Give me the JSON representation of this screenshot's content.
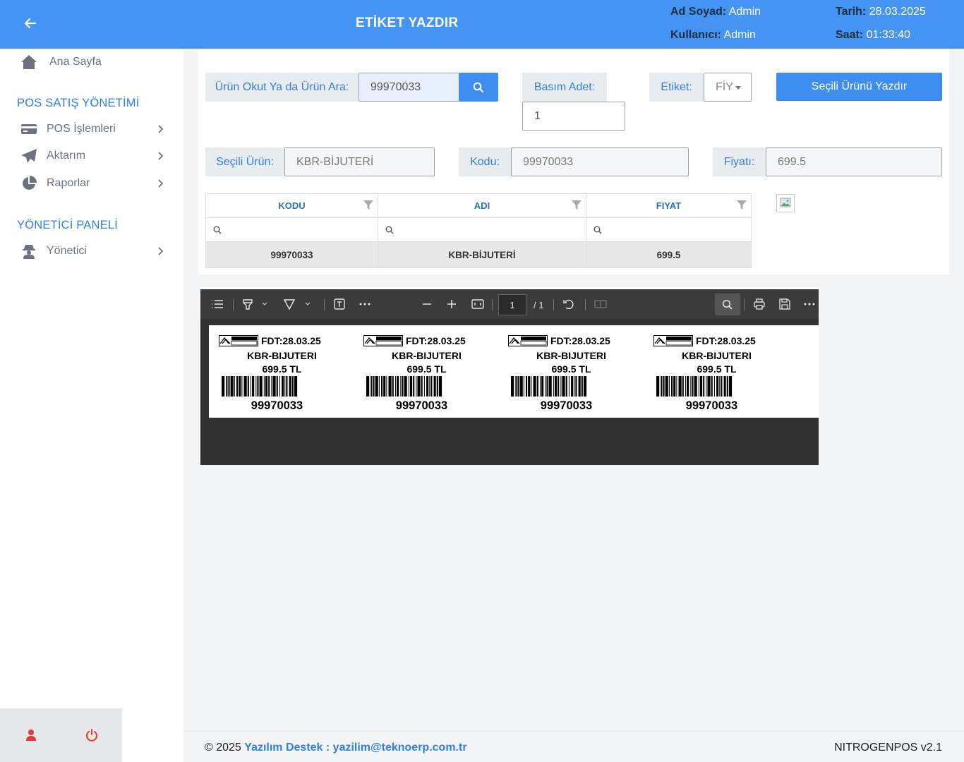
{
  "header": {
    "title": "ETİKET YAZDIR",
    "ad_soyad_label": "Ad Soyad:",
    "ad_soyad_value": "Admin",
    "kullanici_label": "Kullanıcı:",
    "kullanici_value": "Admin",
    "tarih_label": "Tarih:",
    "tarih_value": "28.03.2025",
    "saat_label": "Saat:",
    "saat_value": "01:33:40"
  },
  "sidebar": {
    "home": "Ana Sayfa",
    "section_pos": "POS SATIŞ YÖNETİMİ",
    "pos_islemleri": "POS İşlemleri",
    "aktarim": "Aktarım",
    "raporlar": "Raporlar",
    "section_admin": "YÖNETİCİ PANELİ",
    "yonetici": "Yönetici"
  },
  "form": {
    "search_label": "Ürün Okut Ya da Ürün Ara:",
    "search_value": "99970033",
    "basim_label": "Basım Adet:",
    "basim_value": "1",
    "etiket_label": "Etiket:",
    "etiket_value": "FİY",
    "print_button": "Seçili Ürünü Yazdır",
    "selected_label": "Seçili Ürün:",
    "selected_value": "KBR-BİJUTERİ",
    "kodu_label": "Kodu:",
    "kodu_value": "99970033",
    "fiyat_label": "Fiyatı:",
    "fiyat_value": "699.5"
  },
  "grid": {
    "headers": [
      "KODU",
      "ADI",
      "FIYAT"
    ],
    "rows": [
      [
        "99970033",
        "KBR-BİJUTERİ",
        "699.5"
      ]
    ]
  },
  "pdf_viewer": {
    "page_current": "1",
    "page_total": "/ 1"
  },
  "labels": [
    {
      "fdt": "FDT:28.03.25",
      "name": "KBR-BIJUTERI",
      "price": "699.5 TL",
      "code": "99970033"
    },
    {
      "fdt": "FDT:28.03.25",
      "name": "KBR-BIJUTERI",
      "price": "699.5 TL",
      "code": "99970033"
    },
    {
      "fdt": "FDT:28.03.25",
      "name": "KBR-BIJUTERI",
      "price": "699.5 TL",
      "code": "99970033"
    },
    {
      "fdt": "FDT:28.03.25",
      "name": "KBR-BIJUTERI",
      "price": "699.5 TL",
      "code": "99970033"
    }
  ],
  "footer": {
    "copyright": "© 2025",
    "support": "Yazılım Destek : yazilim@teknoerp.com.tr",
    "version": "NITROGENPOS v2.1"
  }
}
